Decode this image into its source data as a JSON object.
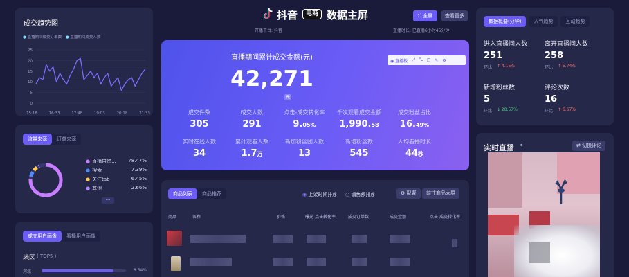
{
  "header": {
    "brand": "抖音",
    "brand_tag": "电商",
    "title": "数据主屏",
    "platform": "开播平台: 抖音",
    "duration": "直播时长: 已直播6小时45分钟",
    "fullscreen_label": "全屏",
    "more_label": "查看更多"
  },
  "trend": {
    "title": "成交趋势图",
    "legend": [
      "直播期间成交订单数",
      "直播期间成交人数"
    ],
    "yticks": [
      "25",
      "20",
      "15",
      "10",
      "5",
      "0"
    ],
    "xticks": [
      "15:18",
      "16:33",
      "17:48",
      "19:03",
      "20:18",
      "21:33"
    ],
    "colors": {
      "line": "#7b6cff"
    },
    "series": [
      9,
      12,
      11,
      18,
      15,
      17,
      10,
      14,
      11,
      9,
      13,
      16,
      20,
      21,
      11,
      13,
      15,
      12,
      14,
      9,
      12,
      14,
      8,
      10,
      12,
      6,
      9,
      11,
      12,
      8,
      11,
      14,
      16
    ]
  },
  "source": {
    "tabs": [
      "流量来源",
      "订单来源"
    ],
    "items": [
      {
        "name": "直播自然...",
        "pct": "78.47%",
        "color": "#c77dff"
      },
      {
        "name": "搜索",
        "pct": "7.39%",
        "color": "#4f8bff"
      },
      {
        "name": "关注tab",
        "pct": "6.45%",
        "color": "#ffc94d"
      },
      {
        "name": "其他",
        "pct": "2.66%",
        "color": "#b085ff"
      }
    ],
    "more": "···",
    "donut": [
      {
        "value": 78.47,
        "color": "#c77dff"
      },
      {
        "value": 7.39,
        "color": "#4f8bff"
      },
      {
        "value": 6.45,
        "color": "#ffc94d"
      },
      {
        "value": 2.66,
        "color": "#b085ff"
      }
    ]
  },
  "portrait": {
    "tabs": [
      "成交用户画像",
      "看播用户画像"
    ],
    "region_label": "地区",
    "region_sub": "( TOP5 )",
    "rows": [
      {
        "name": "河北",
        "pct": "8.54%",
        "fill": 0.854
      }
    ]
  },
  "center": {
    "title": "直播期间累计成交金额(元)",
    "total": "42,271",
    "total_unit": "元",
    "toolbar": [
      "直播板"
    ],
    "metrics": [
      {
        "label": "成交件数",
        "value": "305",
        "unit": ""
      },
      {
        "label": "成交人数",
        "value": "291",
        "unit": ""
      },
      {
        "label": "点击-成交转化率",
        "value": "9.",
        "unit": "05%"
      },
      {
        "label": "千次观看成交金额",
        "value": "1,990.",
        "unit": "58"
      },
      {
        "label": "成交粉丝占比",
        "value": "16.",
        "unit": "49%"
      },
      {
        "label": "实时在线人数",
        "value": "34",
        "unit": ""
      },
      {
        "label": "累计观看人数",
        "value": "1.7",
        "unit": "万"
      },
      {
        "label": "新加粉丝团人数",
        "value": "13",
        "unit": ""
      },
      {
        "label": "新增粉丝数",
        "value": "545",
        "unit": ""
      },
      {
        "label": "人均看播时长",
        "value": "44",
        "unit": "秒"
      }
    ]
  },
  "products": {
    "tabs": [
      "商品列表",
      "商品推荐"
    ],
    "radios": [
      "上架时间排序",
      "销售额排序"
    ],
    "config_label": "配置",
    "goto_label": "前往商品大屏",
    "columns": [
      "商品",
      "名称",
      "价格",
      "曝光-点击转化率",
      "成交订单数",
      "成交金额",
      "点击-成交转化率"
    ]
  },
  "right_stats": {
    "tabs": [
      "数据概要(分钟)",
      "人气趋势",
      "互动趋势"
    ],
    "stats": [
      {
        "label": "进入直播间人数",
        "value": "251",
        "sub_label": "环比",
        "change": "↑ 4.15%",
        "dir": "up"
      },
      {
        "label": "离开直播间人数",
        "value": "258",
        "sub_label": "环比",
        "change": "↑ 5.74%",
        "dir": "up"
      },
      {
        "label": "新增粉丝数",
        "value": "5",
        "sub_label": "环比",
        "change": "↓ 28.57%",
        "dir": "down"
      },
      {
        "label": "评论次数",
        "value": "16",
        "sub_label": "环比",
        "change": "↑ 6.67%",
        "dir": "up"
      }
    ]
  },
  "live": {
    "title": "实时直播",
    "switch_label": "切换评论"
  }
}
